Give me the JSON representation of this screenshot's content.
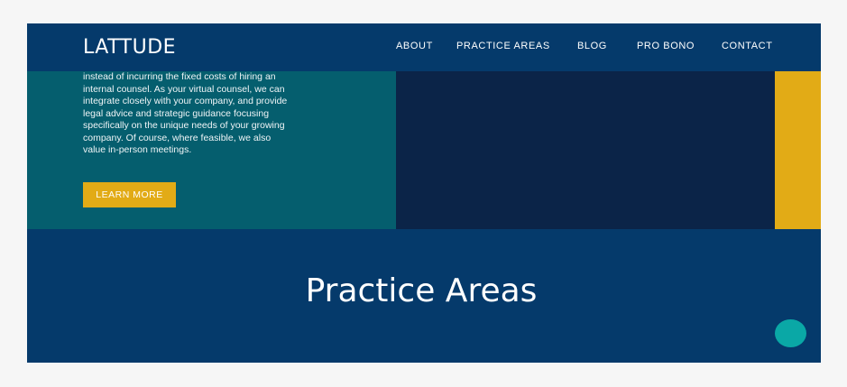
{
  "header": {
    "logo": "LATTUDE",
    "nav": [
      "ABOUT",
      "PRACTICE AREAS",
      "BLOG",
      "PRO BONO",
      "CONTACT"
    ]
  },
  "hero": {
    "paragraph_lines": [
      "instead of incurring the fixed costs of hiring an",
      "internal counsel. As your virtual counsel, we can",
      "integrate closely with your company, and provide",
      "legal advice and strategic guidance focusing",
      "specifically on the unique needs of your growing",
      "company. Of course, where feasible, we also",
      "value in-person meetings."
    ],
    "button_label": "LEARN MORE"
  },
  "practice_areas": {
    "title": "Practice Areas"
  },
  "colors": {
    "navy": "#053a6b",
    "teal": "#055e6e",
    "dark_navy": "#0b2448",
    "gold": "#e2ab16",
    "chat_teal": "#0aa8a6"
  },
  "icons": {
    "chat": "chat-bubble-icon"
  }
}
